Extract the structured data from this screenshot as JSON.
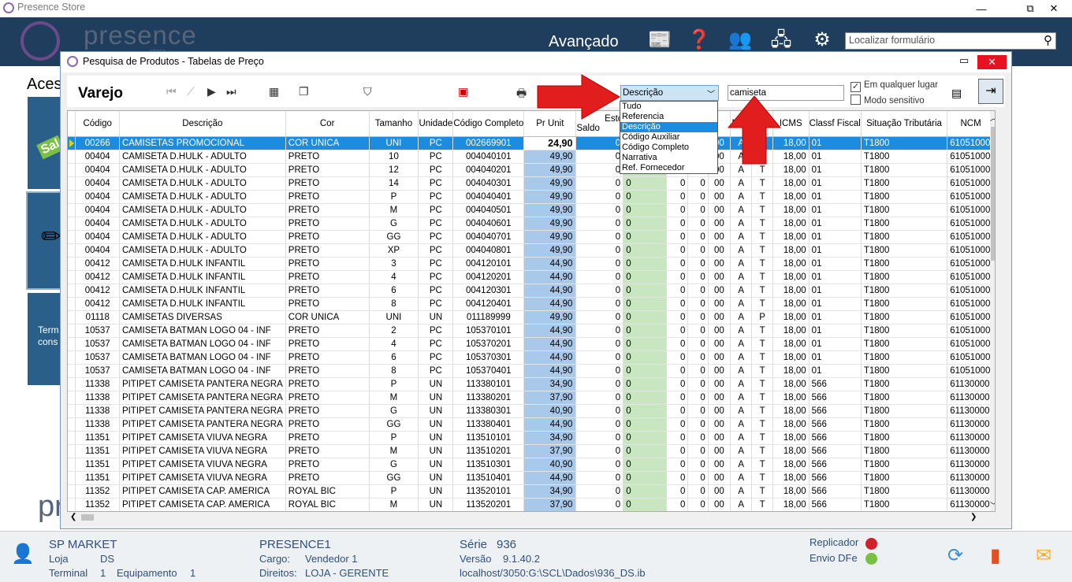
{
  "window": {
    "title": "Presence Store",
    "min": "—",
    "restore": "⧉",
    "close": "✕"
  },
  "appbar": {
    "logo": "presence",
    "logo_sub": "store",
    "advanced_label": "Avançado",
    "search_placeholder": "Localizar formulário"
  },
  "background": {
    "acesso": "Aces",
    "sale_tile": "Sal",
    "terminal_text1": "Term",
    "terminal_text2": "cons",
    "pr_logo": "pr"
  },
  "dialog": {
    "title": "Pesquisa de Produtos - Tabelas de Preço",
    "varejo": "Varejo",
    "search_field": "Descrição",
    "search_text": "camiseta",
    "chk_anywhere": "Em qualquer lugar",
    "chk_sensitive": "Modo sensitivo",
    "dropdown_options": [
      "Tudo",
      "Referencia",
      "Descrição",
      "Código Auxiliar",
      "Código Completo",
      "Narrativa",
      "Ref. Fornecedor"
    ],
    "dropdown_selected": 2
  },
  "grid": {
    "headers": [
      "Código",
      "Descrição",
      "Cor",
      "Tamanho",
      "Unidade",
      "Código Completo",
      "Pr Unit",
      "Esto",
      "Saldo",
      "",
      "",
      "",
      "MAT",
      "",
      "ICMS",
      "Classf Fiscal",
      "Situação Tributária",
      "NCM"
    ],
    "rows": [
      [
        "00266",
        "CAMISETAS PROMOCIONAL",
        "COR UNICA",
        "UNI",
        "PC",
        "002669901",
        "24,90",
        "0",
        "",
        "0",
        "0",
        "00",
        "A",
        "T",
        "18,00",
        "01",
        "T1800",
        "61051000"
      ],
      [
        "00404",
        "CAMISETA D.HULK - ADULTO",
        "PRETO",
        "10",
        "PC",
        "004040101",
        "49,90",
        "0",
        "",
        "0",
        "0",
        "00",
        "A",
        "T",
        "18,00",
        "01",
        "T1800",
        "61051000"
      ],
      [
        "00404",
        "CAMISETA D.HULK - ADULTO",
        "PRETO",
        "12",
        "PC",
        "004040201",
        "49,90",
        "0",
        "",
        "0",
        "0",
        "00",
        "A",
        "T",
        "18,00",
        "01",
        "T1800",
        "61051000"
      ],
      [
        "00404",
        "CAMISETA D.HULK - ADULTO",
        "PRETO",
        "14",
        "PC",
        "004040301",
        "49,90",
        "0",
        "0",
        "0",
        "0",
        "00",
        "A",
        "T",
        "18,00",
        "01",
        "T1800",
        "61051000"
      ],
      [
        "00404",
        "CAMISETA D.HULK - ADULTO",
        "PRETO",
        "P",
        "PC",
        "004040401",
        "49,90",
        "0",
        "0",
        "0",
        "0",
        "00",
        "A",
        "T",
        "18,00",
        "01",
        "T1800",
        "61051000"
      ],
      [
        "00404",
        "CAMISETA D.HULK - ADULTO",
        "PRETO",
        "M",
        "PC",
        "004040501",
        "49,90",
        "0",
        "0",
        "0",
        "0",
        "00",
        "A",
        "T",
        "18,00",
        "01",
        "T1800",
        "61051000"
      ],
      [
        "00404",
        "CAMISETA D.HULK - ADULTO",
        "PRETO",
        "G",
        "PC",
        "004040601",
        "49,90",
        "0",
        "0",
        "0",
        "0",
        "00",
        "A",
        "T",
        "18,00",
        "01",
        "T1800",
        "61051000"
      ],
      [
        "00404",
        "CAMISETA D.HULK - ADULTO",
        "PRETO",
        "GG",
        "PC",
        "004040701",
        "49,90",
        "0",
        "0",
        "0",
        "0",
        "00",
        "A",
        "T",
        "18,00",
        "01",
        "T1800",
        "61051000"
      ],
      [
        "00404",
        "CAMISETA D.HULK - ADULTO",
        "PRETO",
        "XP",
        "PC",
        "004040801",
        "49,90",
        "0",
        "0",
        "0",
        "0",
        "00",
        "A",
        "T",
        "18,00",
        "01",
        "T1800",
        "61051000"
      ],
      [
        "00412",
        "CAMISETA D.HULK INFANTIL",
        "PRETO",
        "3",
        "PC",
        "004120101",
        "44,90",
        "0",
        "0",
        "0",
        "0",
        "00",
        "A",
        "T",
        "18,00",
        "01",
        "T1800",
        "61051000"
      ],
      [
        "00412",
        "CAMISETA D.HULK INFANTIL",
        "PRETO",
        "4",
        "PC",
        "004120201",
        "44,90",
        "0",
        "0",
        "0",
        "0",
        "00",
        "A",
        "T",
        "18,00",
        "01",
        "T1800",
        "61051000"
      ],
      [
        "00412",
        "CAMISETA D.HULK INFANTIL",
        "PRETO",
        "6",
        "PC",
        "004120301",
        "44,90",
        "0",
        "0",
        "0",
        "0",
        "00",
        "A",
        "T",
        "18,00",
        "01",
        "T1800",
        "61051000"
      ],
      [
        "00412",
        "CAMISETA D.HULK INFANTIL",
        "PRETO",
        "8",
        "PC",
        "004120401",
        "44,90",
        "0",
        "0",
        "0",
        "0",
        "00",
        "A",
        "T",
        "18,00",
        "01",
        "T1800",
        "61051000"
      ],
      [
        "01118",
        "CAMISETAS DIVERSAS",
        "COR UNICA",
        "UNI",
        "UN",
        "011189999",
        "49,90",
        "0",
        "0",
        "0",
        "0",
        "00",
        "A",
        "P",
        "18,00",
        "01",
        "T1800",
        "61051000"
      ],
      [
        "10537",
        "CAMISETA BATMAN LOGO 04 - INF",
        "PRETO",
        "2",
        "PC",
        "105370101",
        "44,90",
        "0",
        "0",
        "0",
        "0",
        "00",
        "A",
        "T",
        "18,00",
        "01",
        "T1800",
        "61051000"
      ],
      [
        "10537",
        "CAMISETA BATMAN LOGO 04 - INF",
        "PRETO",
        "4",
        "PC",
        "105370201",
        "44,90",
        "0",
        "0",
        "0",
        "0",
        "00",
        "A",
        "T",
        "18,00",
        "01",
        "T1800",
        "61051000"
      ],
      [
        "10537",
        "CAMISETA BATMAN LOGO 04 - INF",
        "PRETO",
        "6",
        "PC",
        "105370301",
        "44,90",
        "0",
        "0",
        "0",
        "0",
        "00",
        "A",
        "T",
        "18,00",
        "01",
        "T1800",
        "61051000"
      ],
      [
        "10537",
        "CAMISETA BATMAN LOGO 04 - INF",
        "PRETO",
        "8",
        "PC",
        "105370401",
        "44,90",
        "0",
        "0",
        "0",
        "0",
        "00",
        "A",
        "T",
        "18,00",
        "01",
        "T1800",
        "61051000"
      ],
      [
        "11338",
        "PITIPET CAMISETA PANTERA NEGRA",
        "PRETO",
        "P",
        "UN",
        "113380101",
        "34,90",
        "0",
        "0",
        "0",
        "0",
        "00",
        "A",
        "T",
        "18,00",
        "566",
        "T1800",
        "61130000"
      ],
      [
        "11338",
        "PITIPET CAMISETA PANTERA NEGRA",
        "PRETO",
        "M",
        "UN",
        "113380201",
        "37,90",
        "0",
        "0",
        "0",
        "0",
        "00",
        "A",
        "T",
        "18,00",
        "566",
        "T1800",
        "61130000"
      ],
      [
        "11338",
        "PITIPET CAMISETA PANTERA NEGRA",
        "PRETO",
        "G",
        "UN",
        "113380301",
        "40,90",
        "0",
        "0",
        "0",
        "0",
        "00",
        "A",
        "T",
        "18,00",
        "566",
        "T1800",
        "61130000"
      ],
      [
        "11338",
        "PITIPET CAMISETA PANTERA NEGRA",
        "PRETO",
        "GG",
        "UN",
        "113380401",
        "44,90",
        "0",
        "0",
        "0",
        "0",
        "00",
        "A",
        "T",
        "18,00",
        "566",
        "T1800",
        "61130000"
      ],
      [
        "11351",
        "PITIPET CAMISETA VIUVA NEGRA",
        "PRETO",
        "P",
        "UN",
        "113510101",
        "34,90",
        "0",
        "0",
        "0",
        "0",
        "00",
        "A",
        "T",
        "18,00",
        "566",
        "T1800",
        "61130000"
      ],
      [
        "11351",
        "PITIPET CAMISETA VIUVA NEGRA",
        "PRETO",
        "M",
        "UN",
        "113510201",
        "37,90",
        "0",
        "0",
        "0",
        "0",
        "00",
        "A",
        "T",
        "18,00",
        "566",
        "T1800",
        "61130000"
      ],
      [
        "11351",
        "PITIPET CAMISETA VIUVA NEGRA",
        "PRETO",
        "G",
        "UN",
        "113510301",
        "40,90",
        "0",
        "0",
        "0",
        "0",
        "00",
        "A",
        "T",
        "18,00",
        "566",
        "T1800",
        "61130000"
      ],
      [
        "11351",
        "PITIPET CAMISETA VIUVA NEGRA",
        "PRETO",
        "GG",
        "UN",
        "113510401",
        "44,90",
        "0",
        "0",
        "0",
        "0",
        "00",
        "A",
        "T",
        "18,00",
        "566",
        "T1800",
        "61130000"
      ],
      [
        "11352",
        "PITIPET CAMISETA CAP. AMERICA",
        "ROYAL BIC",
        "P",
        "UN",
        "113520101",
        "34,90",
        "0",
        "0",
        "0",
        "0",
        "00",
        "A",
        "T",
        "18,00",
        "566",
        "T1800",
        "61130000"
      ],
      [
        "11352",
        "PITIPET CAMISETA CAP. AMERICA",
        "ROYAL BIC",
        "M",
        "UN",
        "113520201",
        "37,90",
        "0",
        "0",
        "0",
        "0",
        "00",
        "A",
        "T",
        "18,00",
        "566",
        "T1800",
        "61130000"
      ]
    ]
  },
  "status": {
    "company": "SP MARKET",
    "loja_label": "Loja",
    "loja": "DS",
    "terminal_label": "Terminal",
    "terminal": "1",
    "equip_label": "Equipamento",
    "equip": "1",
    "user": "PRESENCE1",
    "cargo_label": "Cargo:",
    "cargo": "Vendedor 1",
    "direitos_label": "Direitos:",
    "direitos": "LOJA - GERENTE",
    "serie_label": "Série",
    "serie": "936",
    "versao_label": "Versão",
    "versao": "9.1.40.2",
    "db_path": "localhost/3050:G:\\SCL\\Dados\\936_DS.ib",
    "replicador": "Replicador",
    "envio": "Envio DFe",
    "colors": {
      "replicador": "#d0202a",
      "envio": "#7ac143"
    }
  }
}
